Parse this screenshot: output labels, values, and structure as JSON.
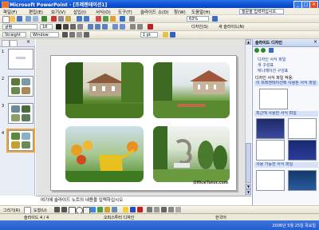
{
  "window": {
    "title": "Microsoft PowerPoint - [프레젠테이션1]",
    "minimize": "_",
    "maximize": "□",
    "close": "×"
  },
  "menu": {
    "items": [
      "파일(F)",
      "편집(E)",
      "보기(V)",
      "삽입(I)",
      "서식(O)",
      "도구(T)",
      "슬라이드 쇼(D)",
      "창(W)",
      "도움말(H)"
    ],
    "help_placeholder": "질문을 입력하십시오."
  },
  "toolbar": {
    "zoom": "63%",
    "font_name": "굴림",
    "font_size": "18",
    "design_label": "디자인(S)",
    "new_slide_label": "새 슬라이드(N)"
  },
  "toolbar3": {
    "style_label": "Straight",
    "window_label": "Window",
    "line_weight": "1 pt"
  },
  "notes": {
    "text": "여기에 슬라이드 노트의 내용을 입력하십시오"
  },
  "taskpane": {
    "title": "슬라이드 디자인",
    "links": [
      "디자인 서식 파일",
      "색 구성표",
      "애니메이션 구성표"
    ],
    "section1": "디자인 서식 파일 적용:",
    "item1": "이 프레젠테이션에 사용된 서식 파일",
    "section2": "최근에 사용한 서식 파일",
    "section3": "사용 가능한 서식 파일"
  },
  "slides": {
    "numbers": [
      "1",
      "2",
      "3",
      "4"
    ],
    "brand": "OfficeTutor.com"
  },
  "drawbar": {
    "draw_label": "그리기(R)",
    "autoshape_label": "도형(U)"
  },
  "status": {
    "slide": "슬라이드 4 / 4",
    "design_info": "오피스투터 디자인",
    "language": "한국어"
  },
  "taskbar": {
    "clock": "2006년 5월 25일 목요일"
  },
  "colors": {
    "titlebar": "#0d4fd1",
    "selection": "#f3a32f",
    "link": "#1c3d9c"
  }
}
